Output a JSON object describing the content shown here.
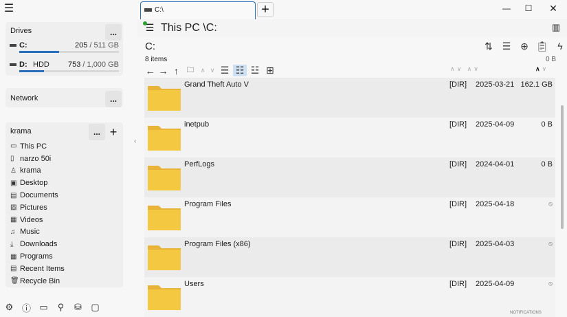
{
  "sidebar": {
    "drives": {
      "title": "Drives",
      "more": "...",
      "items": [
        {
          "letter": "C:",
          "kind": "",
          "used": "205",
          "total": "/ 511 GB",
          "fill": 0.4
        },
        {
          "letter": "D:",
          "kind": "HDD",
          "used": "753",
          "total": "/ 1,000 GB",
          "fill": 0.25
        }
      ]
    },
    "network": {
      "title": "Network",
      "more": "..."
    },
    "user": {
      "title": "krama",
      "more": "...",
      "add": "+",
      "items": [
        {
          "label": "This PC",
          "icon": "pc-icon"
        },
        {
          "label": "narzo 50i",
          "icon": "phone-icon"
        },
        {
          "label": "krama",
          "icon": "user-icon"
        },
        {
          "label": "Desktop",
          "icon": "desktop-icon"
        },
        {
          "label": "Documents",
          "icon": "documents-icon"
        },
        {
          "label": "Pictures",
          "icon": "pictures-icon"
        },
        {
          "label": "Videos",
          "icon": "videos-icon"
        },
        {
          "label": "Music",
          "icon": "music-icon"
        },
        {
          "label": "Downloads",
          "icon": "downloads-icon"
        },
        {
          "label": "Programs",
          "icon": "programs-icon"
        },
        {
          "label": "Recent Items",
          "icon": "recent-icon"
        },
        {
          "label": "Recycle Bin",
          "icon": "recycle-bin-icon"
        }
      ]
    }
  },
  "tab": {
    "title": "C:\\",
    "new": "+"
  },
  "header": {
    "path": "This PC \\C:"
  },
  "location": {
    "title": "C:",
    "count": "8 items",
    "selected_size": "0 B"
  },
  "files": [
    {
      "name": "Grand Theft Auto V",
      "type": "[DIR]",
      "date": "2025-03-21",
      "size": "162.1 GB"
    },
    {
      "name": "inetpub",
      "type": "[DIR]",
      "date": "2025-04-09",
      "size": "0 B"
    },
    {
      "name": "PerfLogs",
      "type": "[DIR]",
      "date": "2024-04-01",
      "size": "0 B"
    },
    {
      "name": "Program Files",
      "type": "[DIR]",
      "date": "2025-04-18",
      "size": "⦸"
    },
    {
      "name": "Program Files (x86)",
      "type": "[DIR]",
      "date": "2025-04-03",
      "size": "⦸"
    },
    {
      "name": "Users",
      "type": "[DIR]",
      "date": "2025-04-09",
      "size": "⦸"
    }
  ],
  "status": {
    "notifications": "NOTIFICATIONS"
  },
  "colors": {
    "accent": "#2a6fba",
    "folder": "#f5c842"
  }
}
